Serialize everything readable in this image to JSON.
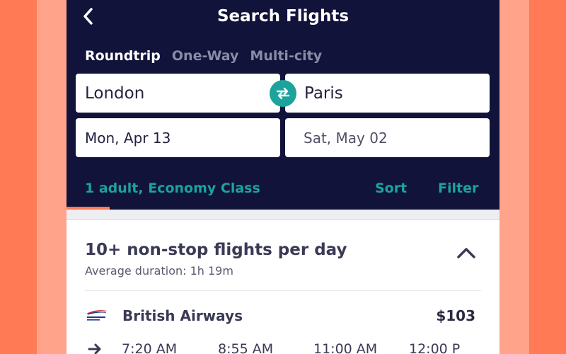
{
  "header": {
    "title": "Search Flights"
  },
  "trip_types": [
    {
      "label": "Roundtrip",
      "active": true
    },
    {
      "label": "One-Way",
      "active": false
    },
    {
      "label": "Multi-city",
      "active": false
    }
  ],
  "search": {
    "origin": "London",
    "destination": "Paris",
    "depart_date": "Mon, Apr 13",
    "return_date": "Sat, May 02"
  },
  "options": {
    "passengers": "1 adult, Economy Class",
    "sort_label": "Sort",
    "filter_label": "Filter"
  },
  "loading_progress": 0.1,
  "group": {
    "title": "10+ non-stop flights per day",
    "subtitle": "Average duration: 1h 19m"
  },
  "flight": {
    "airline": "British Airways",
    "price": "$103",
    "times": [
      "7:20 AM",
      "8:55 AM",
      "11:00 AM",
      "12:00 P"
    ]
  },
  "colors": {
    "background": "#FF7A55",
    "header": "#12133A",
    "accent": "#1BA39C"
  },
  "icons": {
    "back": "chevron-left-icon",
    "swap": "swap-arrows-icon",
    "collapse": "chevron-up-icon",
    "direction": "arrow-right-icon",
    "airline_logo": "british-airways-logo"
  }
}
